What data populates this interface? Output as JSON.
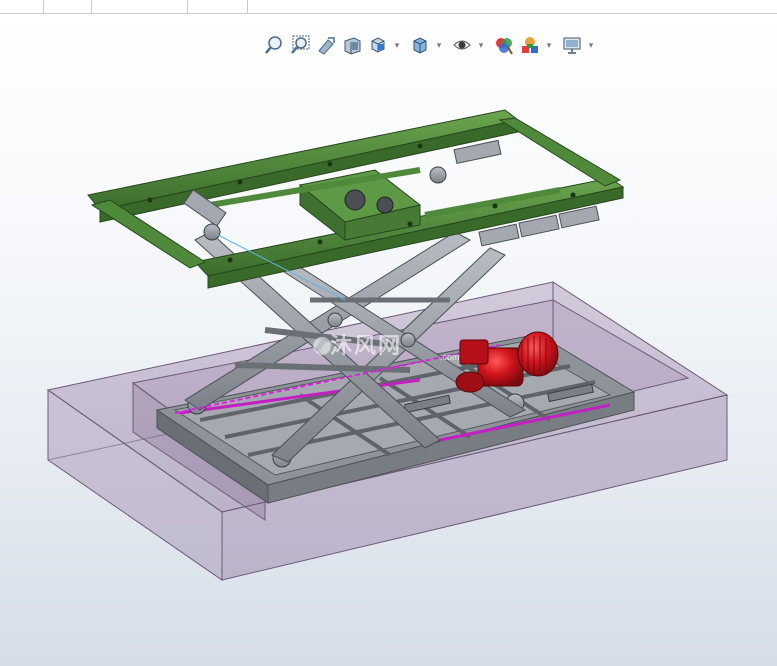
{
  "window": {
    "tab_count": 4
  },
  "heads_up_toolbar": {
    "buttons": [
      {
        "icon": "zoom-to-fit-icon",
        "has_dropdown": false
      },
      {
        "icon": "zoom-to-area-icon",
        "has_dropdown": false
      },
      {
        "icon": "previous-view-icon",
        "has_dropdown": false
      },
      {
        "icon": "section-view-icon",
        "has_dropdown": false
      },
      {
        "icon": "view-orientation-icon",
        "has_dropdown": true
      },
      {
        "icon": "display-style-icon",
        "has_dropdown": true
      },
      {
        "icon": "hide-show-items-icon",
        "has_dropdown": true
      },
      {
        "icon": "edit-appearance-icon",
        "has_dropdown": false
      },
      {
        "icon": "apply-scene-icon",
        "has_dropdown": true
      },
      {
        "icon": "view-settings-icon",
        "has_dropdown": true
      }
    ]
  },
  "model": {
    "description_colors": {
      "frame_green": "#4f8a3a",
      "frame_green_dark": "#2f5a22",
      "steel_gray": "#9a9fa6",
      "steel_dark": "#5c6168",
      "motor_red": "#c8141e",
      "pit_transparent": "#8c6f99",
      "centerline_magenta": "#e020e0"
    }
  },
  "watermark": {
    "text": "沐风网",
    "subtext": ".com"
  }
}
